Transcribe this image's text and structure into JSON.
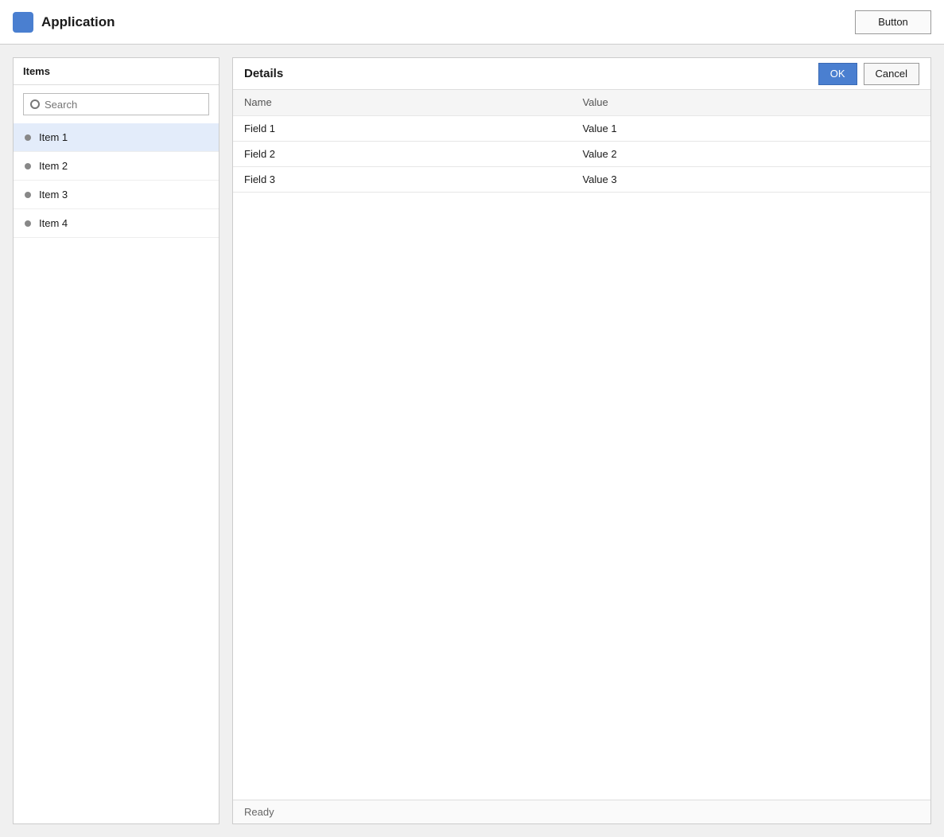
{
  "app": {
    "title": "Application",
    "header_button": "Button"
  },
  "sidebar": {
    "heading": "Items",
    "search_placeholder": "Search",
    "items": [
      {
        "label": "Item 1"
      },
      {
        "label": "Item 2"
      },
      {
        "label": "Item 3"
      },
      {
        "label": "Item 4"
      }
    ]
  },
  "main": {
    "heading": "Details",
    "primary_button": "OK",
    "secondary_button": "Cancel",
    "columns": [
      "Name",
      "Value"
    ],
    "rows": [
      [
        "Field 1",
        "Value 1"
      ],
      [
        "Field 2",
        "Value 2"
      ],
      [
        "Field 3",
        "Value 3"
      ]
    ],
    "status": "Ready"
  }
}
